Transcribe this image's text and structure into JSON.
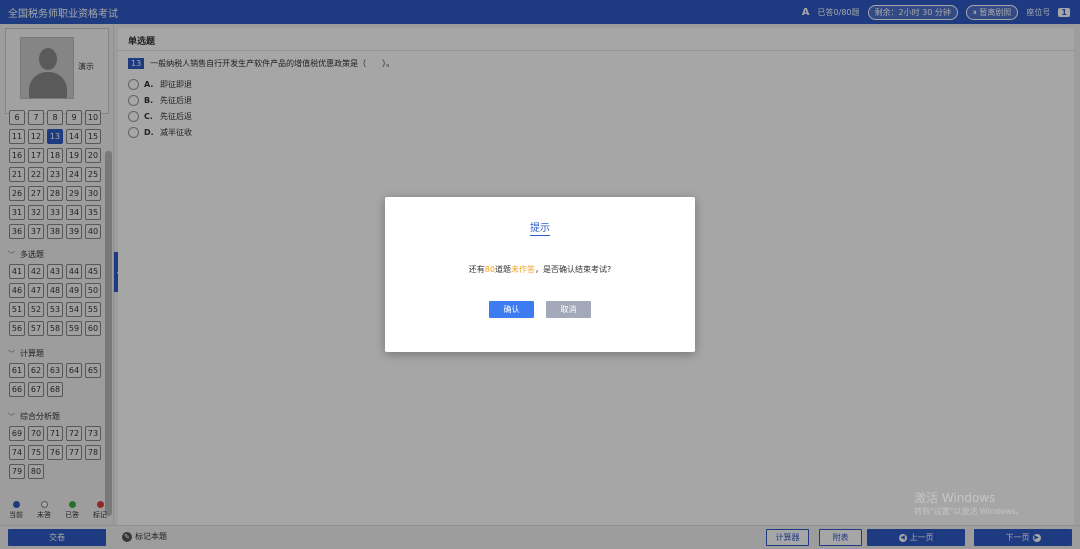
{
  "app": {
    "title": "全国税务师职业资格考试"
  },
  "topbar": {
    "font_icon": "A",
    "answered": "已答0/80题",
    "remaining": "剩余：2小时 30 分钟",
    "pause_label": "暂离剧照",
    "seat_label": "座位号",
    "seat_number": "1"
  },
  "profile": {
    "name": "演示"
  },
  "nav": {
    "section1_rows": [
      [
        "6",
        "7",
        "8",
        "9",
        "10"
      ],
      [
        "11",
        "12",
        "13",
        "14",
        "15"
      ],
      [
        "16",
        "17",
        "18",
        "19",
        "20"
      ],
      [
        "21",
        "22",
        "23",
        "24",
        "25"
      ],
      [
        "26",
        "27",
        "28",
        "29",
        "30"
      ],
      [
        "31",
        "32",
        "33",
        "34",
        "35"
      ],
      [
        "36",
        "37",
        "38",
        "39",
        "40"
      ]
    ],
    "section2_label": "多选题",
    "section2_rows": [
      [
        "41",
        "42",
        "43",
        "44",
        "45"
      ],
      [
        "46",
        "47",
        "48",
        "49",
        "50"
      ],
      [
        "51",
        "52",
        "53",
        "54",
        "55"
      ],
      [
        "56",
        "57",
        "58",
        "59",
        "60"
      ]
    ],
    "section3_label": "计算题",
    "section3_rows": [
      [
        "61",
        "62",
        "63",
        "64",
        "65"
      ],
      [
        "66",
        "67",
        "68"
      ]
    ],
    "section4_label": "综合分析题",
    "section4_rows": [
      [
        "69",
        "70",
        "71",
        "72",
        "73"
      ],
      [
        "74",
        "75",
        "76",
        "77",
        "78"
      ],
      [
        "79",
        "80"
      ]
    ],
    "current": "13"
  },
  "legend": {
    "current": "当前",
    "unanswered": "未答",
    "answered": "已答",
    "marked": "标记",
    "colors": {
      "current": "#2f5bc8",
      "unanswered": "#ffffff",
      "answered": "#3cb043",
      "marked": "#e04040"
    }
  },
  "question": {
    "type": "单选题",
    "number": "13",
    "text": "一般纳税人销售自行开发生产软件产品的增值税优惠政策是（　　）。",
    "options": [
      {
        "letter": "A.",
        "text": "即征即退"
      },
      {
        "letter": "B.",
        "text": "先征后退"
      },
      {
        "letter": "C.",
        "text": "先征后返"
      },
      {
        "letter": "D.",
        "text": "减半征收"
      }
    ]
  },
  "bottombar": {
    "submit": "交卷",
    "mark": "标记本题",
    "calculator": "计算器",
    "attachment": "附表",
    "prev": "上一页",
    "next": "下一页"
  },
  "modal": {
    "title": "提示",
    "msg_prefix": "还有",
    "msg_count": "80",
    "msg_middle": "道题",
    "msg_unanswered": "未作答",
    "msg_suffix": "，是否确认结束考试?",
    "ok": "确认",
    "cancel": "取消"
  },
  "watermark": {
    "line1": "激活 Windows",
    "line2": "转到\"设置\"以激活 Windows。"
  },
  "colors": {
    "brand": "#2f5bc8",
    "highlight": "#f0a020",
    "confirm": "#3d7cf0",
    "cancel": "#a3a9b8"
  }
}
